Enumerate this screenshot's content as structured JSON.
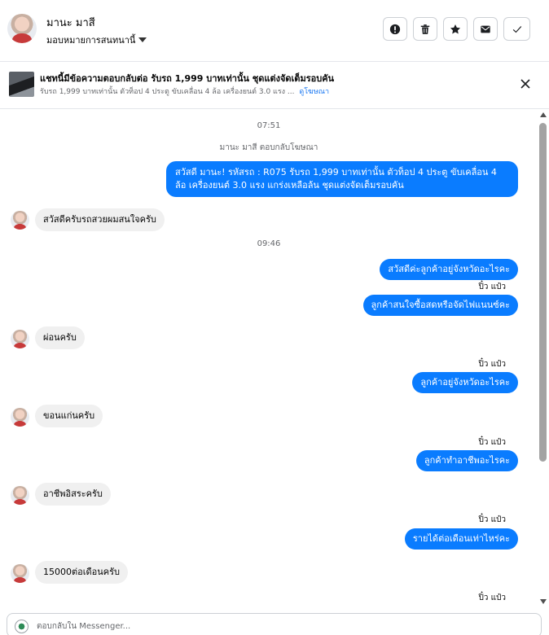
{
  "header": {
    "contact_name": "มานะ มาสี",
    "assign_label": "มอบหมายการสนทนานี้",
    "actions": [
      {
        "name": "mark-spam-button",
        "icon": "alert-icon"
      },
      {
        "name": "delete-button",
        "icon": "trash-icon"
      },
      {
        "name": "star-button",
        "icon": "star-icon"
      },
      {
        "name": "mark-unread-button",
        "icon": "envelope-icon"
      },
      {
        "name": "mark-done-button",
        "icon": "check-icon"
      }
    ]
  },
  "ad_banner": {
    "title": "แชทนี้มีข้อความตอบกลับต่อ รับรถ 1,999 บาทเท่านั้น ชุดแต่งจัดเต็มรอบคัน",
    "subtitle": "รับรถ 1,999 บาทเท่านั้น ตัวท็อป 4 ประตู ขับเคลื่อน 4 ล้อ เครื่องยนต์ 3.0 แรง ...",
    "link": "ดูโฆษณา"
  },
  "chat": {
    "ts1": "07:51",
    "reply_note": "มานะ มาสี ตอบกลับโฆษณา",
    "ad_message": "สวัสดี มานะ! รหัสรถ : R075 รับรถ 1,999 บาทเท่านั้น ตัวท็อป 4 ประตู ขับเคลื่อน 4 ล้อ เครื่องยนต์ 3.0 แรง แกร่งเหลือล้น ชุดแต่งจัดเต็มรอบคัน",
    "in1": "สวัสดีครับรถสวยผมสนใจครับ",
    "ts2": "09:46",
    "out1": "สวัสดีค่ะลูกค้าอยู่จังหวัดอะไรคะ",
    "sender1": "ปิ๋ว แป๋ว",
    "out2": "ลูกค้าสนใจซื้อสดหรือจัดไฟแนนซ์คะ",
    "in2": "ผ่อนครับ",
    "sender2": "ปิ๋ว แป๋ว",
    "out3": "ลูกค้าอยู่จังหวัดอะไรคะ",
    "in3": "ขอนแก่นครับ",
    "sender3": "ปิ๋ว แป๋ว",
    "out4": "ลูกค้าทำอาชีพอะไรคะ",
    "in4": "อาชีพอิสระครับ",
    "sender4": "ปิ๋ว แป๋ว",
    "out5": "รายได้ต่อเดือนเท่าไหร่คะ",
    "in5": "15000ต่อเดือนครับ",
    "sender5": "ปิ๋ว แป๋ว"
  },
  "composer": {
    "placeholder": "ตอบกลับใน Messenger..."
  },
  "colors": {
    "outgoing_bubble": "#0a7cff",
    "incoming_bubble": "#f0f0f0",
    "link": "#1877f2"
  }
}
